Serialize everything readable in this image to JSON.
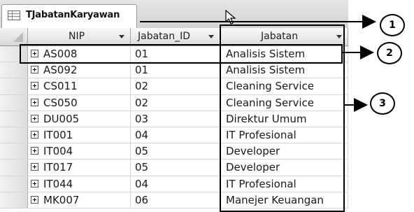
{
  "table": {
    "tab_title": "TJabatanKaryawan",
    "columns": [
      {
        "label": "NIP"
      },
      {
        "label": "Jabatan_ID"
      },
      {
        "label": "Jabatan"
      }
    ],
    "rows": [
      {
        "nip": "AS008",
        "jabatan_id": "01",
        "jabatan": "Analisis Sistem"
      },
      {
        "nip": "AS092",
        "jabatan_id": "01",
        "jabatan": "Analisis Sistem"
      },
      {
        "nip": "CS011",
        "jabatan_id": "02",
        "jabatan": "Cleaning Service"
      },
      {
        "nip": "CS050",
        "jabatan_id": "02",
        "jabatan": "Cleaning Service"
      },
      {
        "nip": "DU005",
        "jabatan_id": "03",
        "jabatan": "Direktur Umum"
      },
      {
        "nip": "IT001",
        "jabatan_id": "04",
        "jabatan": "IT Profesional"
      },
      {
        "nip": "IT004",
        "jabatan_id": "05",
        "jabatan": "Developer"
      },
      {
        "nip": "IT017",
        "jabatan_id": "05",
        "jabatan": "Developer"
      },
      {
        "nip": "IT044",
        "jabatan_id": "04",
        "jabatan": "IT Profesional"
      },
      {
        "nip": "MK007",
        "jabatan_id": "06",
        "jabatan": "Manejer Keuangan"
      }
    ]
  },
  "callouts": [
    {
      "label": "1"
    },
    {
      "label": "2"
    },
    {
      "label": "3"
    }
  ],
  "colors": {
    "border": "#000000",
    "header_bg": "#e0e0e0"
  }
}
